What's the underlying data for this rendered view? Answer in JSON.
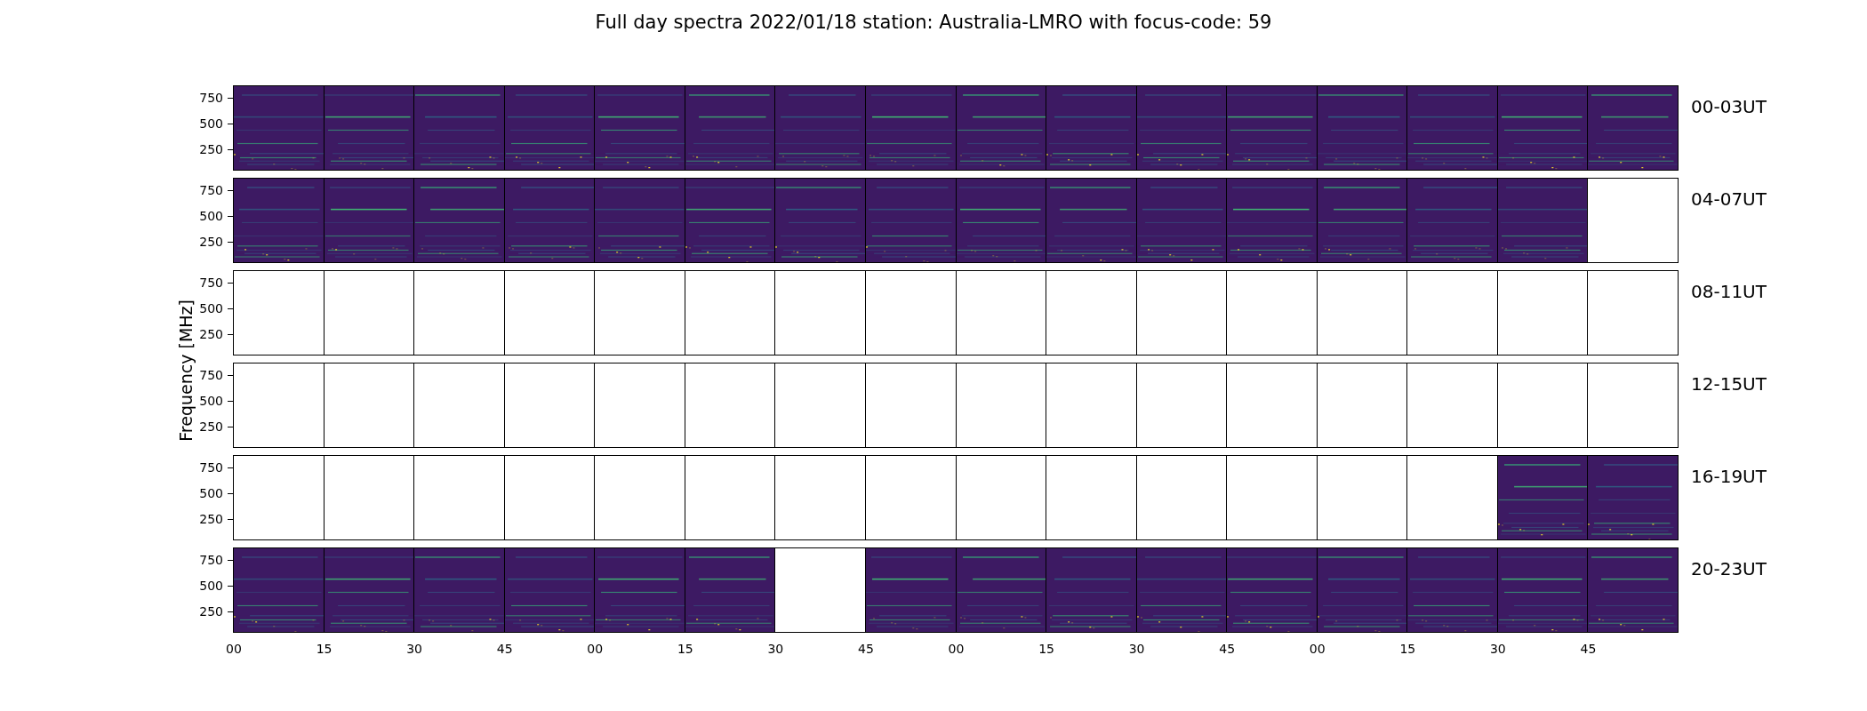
{
  "title": "Full day spectra 2022/01/18 station: Australia-LMRO with focus-code: 59",
  "ylabel": "Frequency [MHz]",
  "rows": [
    {
      "label": "00-03UT",
      "yticks": [
        "750",
        "500",
        "250"
      ],
      "panels": [
        {
          "has_data": true
        },
        {
          "has_data": true
        },
        {
          "has_data": true
        },
        {
          "has_data": true
        },
        {
          "has_data": true
        },
        {
          "has_data": true
        },
        {
          "has_data": true
        },
        {
          "has_data": true
        },
        {
          "has_data": true
        },
        {
          "has_data": true
        },
        {
          "has_data": true
        },
        {
          "has_data": true
        },
        {
          "has_data": true
        },
        {
          "has_data": true
        },
        {
          "has_data": true
        },
        {
          "has_data": true
        }
      ]
    },
    {
      "label": "04-07UT",
      "yticks": [
        "750",
        "500",
        "250"
      ],
      "panels": [
        {
          "has_data": true
        },
        {
          "has_data": true
        },
        {
          "has_data": true
        },
        {
          "has_data": true
        },
        {
          "has_data": true
        },
        {
          "has_data": true
        },
        {
          "has_data": true
        },
        {
          "has_data": true
        },
        {
          "has_data": true
        },
        {
          "has_data": true
        },
        {
          "has_data": true
        },
        {
          "has_data": true
        },
        {
          "has_data": true
        },
        {
          "has_data": true
        },
        {
          "has_data": true
        },
        {
          "has_data": false
        }
      ]
    },
    {
      "label": "08-11UT",
      "yticks": [
        "750",
        "500",
        "250"
      ],
      "panels": [
        {
          "has_data": false
        },
        {
          "has_data": false
        },
        {
          "has_data": false
        },
        {
          "has_data": false
        },
        {
          "has_data": false
        },
        {
          "has_data": false
        },
        {
          "has_data": false
        },
        {
          "has_data": false
        },
        {
          "has_data": false
        },
        {
          "has_data": false
        },
        {
          "has_data": false
        },
        {
          "has_data": false
        },
        {
          "has_data": false
        },
        {
          "has_data": false
        },
        {
          "has_data": false
        },
        {
          "has_data": false
        }
      ]
    },
    {
      "label": "12-15UT",
      "yticks": [
        "750",
        "500",
        "250"
      ],
      "panels": [
        {
          "has_data": false
        },
        {
          "has_data": false
        },
        {
          "has_data": false
        },
        {
          "has_data": false
        },
        {
          "has_data": false
        },
        {
          "has_data": false
        },
        {
          "has_data": false
        },
        {
          "has_data": false
        },
        {
          "has_data": false
        },
        {
          "has_data": false
        },
        {
          "has_data": false
        },
        {
          "has_data": false
        },
        {
          "has_data": false
        },
        {
          "has_data": false
        },
        {
          "has_data": false
        },
        {
          "has_data": false
        }
      ]
    },
    {
      "label": "16-19UT",
      "yticks": [
        "750",
        "500",
        "250"
      ],
      "panels": [
        {
          "has_data": false
        },
        {
          "has_data": false
        },
        {
          "has_data": false
        },
        {
          "has_data": false
        },
        {
          "has_data": false
        },
        {
          "has_data": false
        },
        {
          "has_data": false
        },
        {
          "has_data": false
        },
        {
          "has_data": false
        },
        {
          "has_data": false
        },
        {
          "has_data": false
        },
        {
          "has_data": false
        },
        {
          "has_data": false
        },
        {
          "has_data": false
        },
        {
          "has_data": true
        },
        {
          "has_data": true
        }
      ]
    },
    {
      "label": "20-23UT",
      "yticks": [
        "750",
        "500",
        "250"
      ],
      "panels": [
        {
          "has_data": true
        },
        {
          "has_data": true
        },
        {
          "has_data": true
        },
        {
          "has_data": true
        },
        {
          "has_data": true
        },
        {
          "has_data": true
        },
        {
          "has_data": false
        },
        {
          "has_data": true
        },
        {
          "has_data": true
        },
        {
          "has_data": true
        },
        {
          "has_data": true
        },
        {
          "has_data": true
        },
        {
          "has_data": true
        },
        {
          "has_data": true
        },
        {
          "has_data": true
        },
        {
          "has_data": true
        }
      ]
    }
  ],
  "xticks": [
    "00",
    "15",
    "30",
    "45",
    "00",
    "15",
    "30",
    "45",
    "00",
    "15",
    "30",
    "45",
    "00",
    "15",
    "30",
    "45"
  ]
}
